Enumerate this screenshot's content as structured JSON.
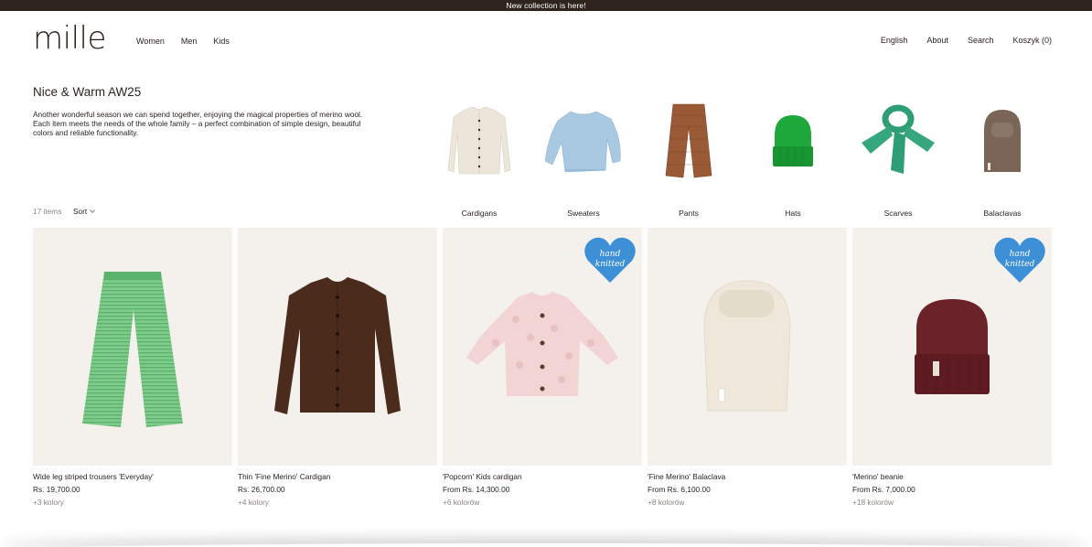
{
  "announcement": "New collection is here!",
  "logo": "mille",
  "nav_left": [
    "Women",
    "Men",
    "Kids"
  ],
  "nav_right": [
    "English",
    "About",
    "Search",
    "Koszyk (0)"
  ],
  "hero": {
    "title": "Nice & Warm AW25",
    "text": "Another wonderful season we can spend together, enjoying the magical properties of merino wool. Each item meets the needs of the whole family – a perfect combination of simple design, beautiful colors and reliable functionality."
  },
  "categories": [
    "Cardigans",
    "Sweaters",
    "Pants",
    "Hats",
    "Scarves",
    "Balaclavas"
  ],
  "listing": {
    "count": "17 items",
    "sort_label": "Sort"
  },
  "badge_text": "hand knitted",
  "products": [
    {
      "name": "Wide leg striped trousers 'Everyday'",
      "price": "Rs. 19,700.00",
      "colors": "+3 kolory"
    },
    {
      "name": "Thin 'Fine Merino' Cardigan",
      "price": "Rs. 26,700.00",
      "colors": "+4 kolory"
    },
    {
      "name": "'Popcorn' Kids cardigan",
      "price": "From Rs. 14,300.00",
      "colors": "+6 kolorów"
    },
    {
      "name": "'Fine Merino' Balaclava",
      "price": "From Rs. 6,100.00",
      "colors": "+8 kolorów"
    },
    {
      "name": "'Merino' beanie",
      "price": "From Rs. 7,000.00",
      "colors": "+18 kolorów"
    }
  ],
  "colors": {
    "announce_bg": "#2e241d",
    "card_bg": "#f4f1ec",
    "badge_blue": "#3d8fd6",
    "green_pants": "#6fc27f",
    "brown_cardigan": "#4a2b1c",
    "pink_cardigan": "#f2d4d4",
    "cream_balaclava": "#efe8da",
    "burgundy_beanie": "#6b2228"
  }
}
